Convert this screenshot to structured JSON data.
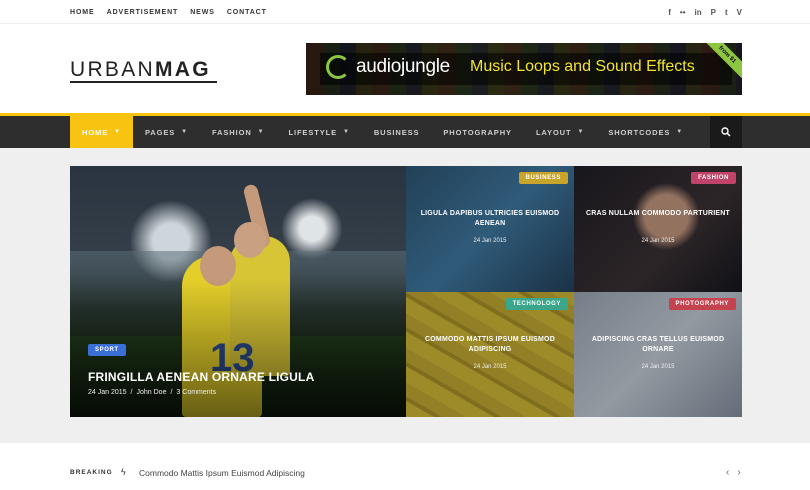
{
  "top_nav": [
    "HOME",
    "ADVERTISEMENT",
    "NEWS",
    "CONTACT"
  ],
  "social_icons": [
    "facebook-icon",
    "flickr-icon",
    "linkedin-icon",
    "pinterest-icon",
    "twitter-icon",
    "vimeo-icon"
  ],
  "social_glyphs": [
    "f",
    "••",
    "in",
    "P",
    "t",
    "V"
  ],
  "logo": {
    "light": "URBAN",
    "bold": "MAG"
  },
  "banner": {
    "brand": "audiojungle",
    "tagline": "Music Loops and Sound Effects",
    "ribbon": "from $1"
  },
  "main_nav": [
    {
      "label": "HOME",
      "dropdown": true,
      "active": true
    },
    {
      "label": "PAGES",
      "dropdown": true
    },
    {
      "label": "FASHION",
      "dropdown": true
    },
    {
      "label": "LIFESTYLE",
      "dropdown": true
    },
    {
      "label": "BUSINESS",
      "dropdown": false
    },
    {
      "label": "PHOTOGRAPHY",
      "dropdown": false
    },
    {
      "label": "LAYOUT",
      "dropdown": true
    },
    {
      "label": "SHORTCODES",
      "dropdown": true
    }
  ],
  "featured": {
    "main": {
      "category": "SPORT",
      "title": "FRINGILLA AENEAN ORNARE LIGULA",
      "date": "24 Jan 2015",
      "author": "John Doe",
      "comments": "3 Comments",
      "jersey_number": "13"
    },
    "tiles": [
      {
        "category": "BUSINESS",
        "title": "LIGULA DAPIBUS ULTRICIES EUISMOD AENEAN",
        "date": "24 Jan 2015"
      },
      {
        "category": "FASHION",
        "title": "CRAS NULLAM COMMODO PARTURIENT",
        "date": "24 Jan 2015"
      },
      {
        "category": "TECHNOLOGY",
        "title": "COMMODO MATTIS IPSUM EUISMOD ADIPISCING",
        "date": "24 Jan 2015"
      },
      {
        "category": "PHOTOGRAPHY",
        "title": "ADIPISCING CRAS TELLUS EUISMOD ORNARE",
        "date": "24 Jan 2015"
      }
    ]
  },
  "breaking": {
    "label": "BREAKING",
    "text": "Commodo Mattis Ipsum Euismod Adipiscing",
    "prev": "‹",
    "next": "›"
  },
  "colors": {
    "accent": "#f9c411",
    "nav_bg": "#2e2e2e",
    "sport": "#3a6fd8"
  }
}
